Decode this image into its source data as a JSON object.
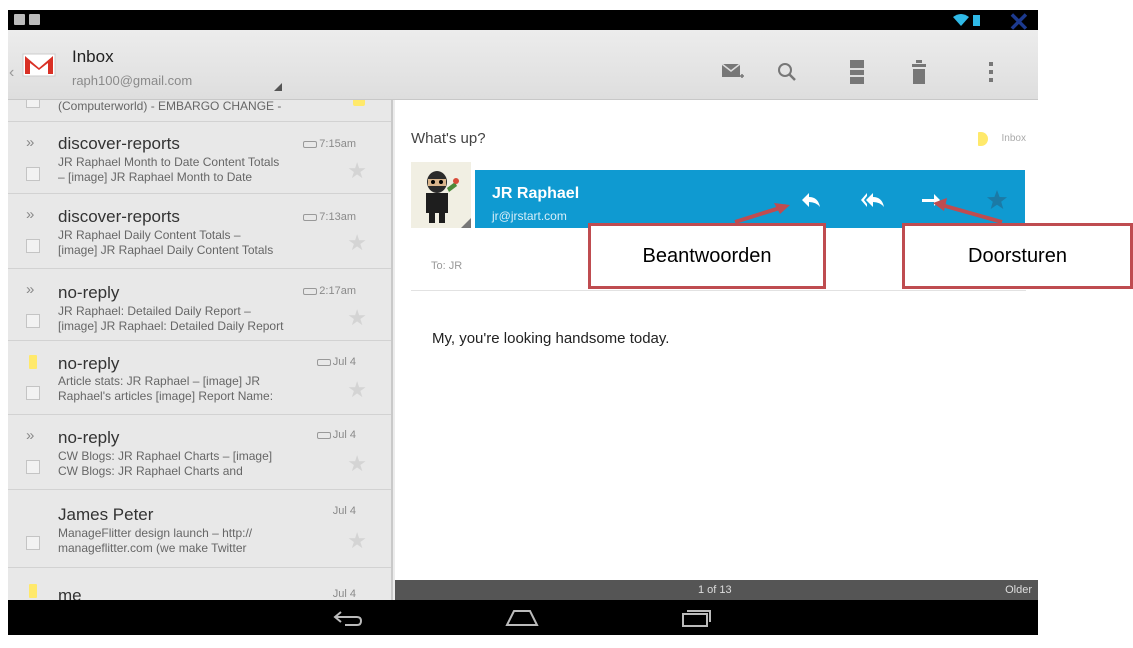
{
  "header": {
    "title": "Inbox",
    "account": "raph100@gmail.com",
    "icons": [
      "back-icon",
      "gmail-logo",
      "compose-icon",
      "search-icon",
      "archive-icon",
      "delete-icon",
      "overflow-menu-icon",
      "close-icon"
    ]
  },
  "list": {
    "partial_row": {
      "subject": "(Computerworld) - EMBARGO CHANGE -"
    },
    "rows": [
      {
        "sender": "discover-reports",
        "line1": "JR Raphael Month to Date Content Totals",
        "line2": "– [image] JR Raphael Month to Date",
        "time": "7:15am"
      },
      {
        "sender": "discover-reports",
        "line1": "JR Raphael Daily Content Totals –",
        "line2": "[image] JR Raphael Daily Content Totals",
        "time": "7:13am"
      },
      {
        "sender": "no-reply",
        "line1": "JR Raphael: Detailed Daily Report –",
        "line2": "[image] JR Raphael: Detailed Daily Report",
        "time": "2:17am"
      },
      {
        "sender": "no-reply",
        "line1": "Article stats: JR Raphael – [image] JR",
        "line2": "Raphael's articles [image] Report Name:",
        "time": "Jul 4"
      },
      {
        "sender": "no-reply",
        "line1": "CW Blogs: JR Raphael Charts – [image]",
        "line2": "CW Blogs: JR Raphael Charts and",
        "time": "Jul 4"
      },
      {
        "sender": "James Peter",
        "line1": "ManageFlitter design launch – http://",
        "line2": "manageflitter.com (we make Twitter",
        "time": "Jul 4"
      },
      {
        "sender": "me",
        "line1": "",
        "line2": "",
        "time": "Jul 4"
      }
    ]
  },
  "message": {
    "subject": "What's up?",
    "label": "Inbox",
    "sender_name": "JR Raphael",
    "sender_email": "jr@jrstart.com",
    "to": "To: JR",
    "body": "My, you're looking handsome today.",
    "icons": [
      "reply-icon",
      "reply-all-icon",
      "forward-icon",
      "star-icon"
    ]
  },
  "footer": {
    "pager": "1 of 13",
    "older": "Older"
  },
  "nav": {
    "icons": [
      "nav-back-icon",
      "nav-home-icon",
      "nav-recents-icon"
    ]
  },
  "callouts": {
    "reply": "Beantwoorden",
    "forward": "Doorsturen"
  },
  "colors": {
    "accent_blue": "#0f9ad1",
    "callout_border": "#bf4c50",
    "close_x": "#1c3a8f",
    "flag_yellow": "#ffe96b"
  }
}
